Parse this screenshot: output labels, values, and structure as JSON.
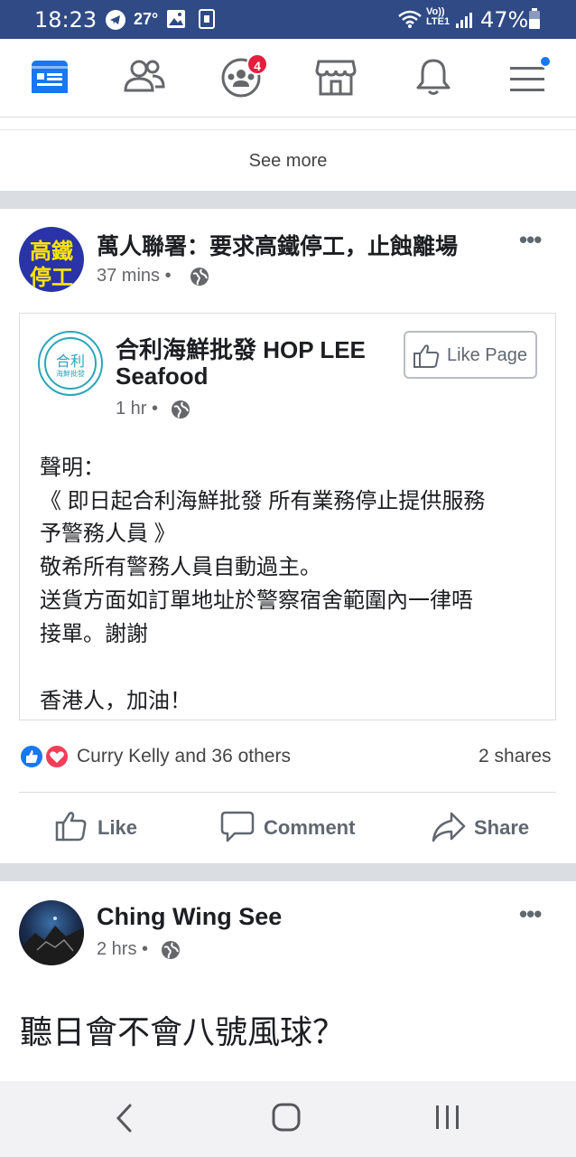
{
  "status_bar": {
    "time": "18:23",
    "temperature": "27°",
    "network_top": "Vo))",
    "network_bottom": "LTE1",
    "battery": "47%"
  },
  "nav": {
    "groups_badge": "4"
  },
  "see_more": "See more",
  "post1": {
    "avatar_text_line1": "高鐵",
    "avatar_text_line2": "停工",
    "author": "萬人聯署：要求高鐵停工，止蝕離場",
    "time": "37 mins",
    "shared_page": {
      "logo_text": "合利",
      "logo_subtext": "海鮮批發",
      "name_line1": "合利海鮮批發 HOP LEE",
      "name_line2": "Seafood",
      "time": "1 hr",
      "like_page": "Like Page"
    },
    "body_lines": [
      "聲明：",
      "《 即日起合利海鮮批發 所有業務停止提供服務",
      "予警務人員 》",
      "敬希所有警務人員自動過主。",
      "送貨方面如訂單地址於警察宿舍範圍內一律唔",
      "接單。謝謝",
      "",
      "香港人，加油！"
    ],
    "reactions_text": "Curry Kelly and 36 others",
    "shares": "2 shares",
    "actions": {
      "like": "Like",
      "comment": "Comment",
      "share": "Share"
    }
  },
  "post2": {
    "author": "Ching Wing See",
    "time": "2 hrs",
    "body": "聽日會不會八號風球？"
  },
  "colors": {
    "status_bar": "#2f4a85",
    "facebook_blue": "#1877f2",
    "badge_red": "#e41e3f",
    "separator": "#dadde1"
  }
}
